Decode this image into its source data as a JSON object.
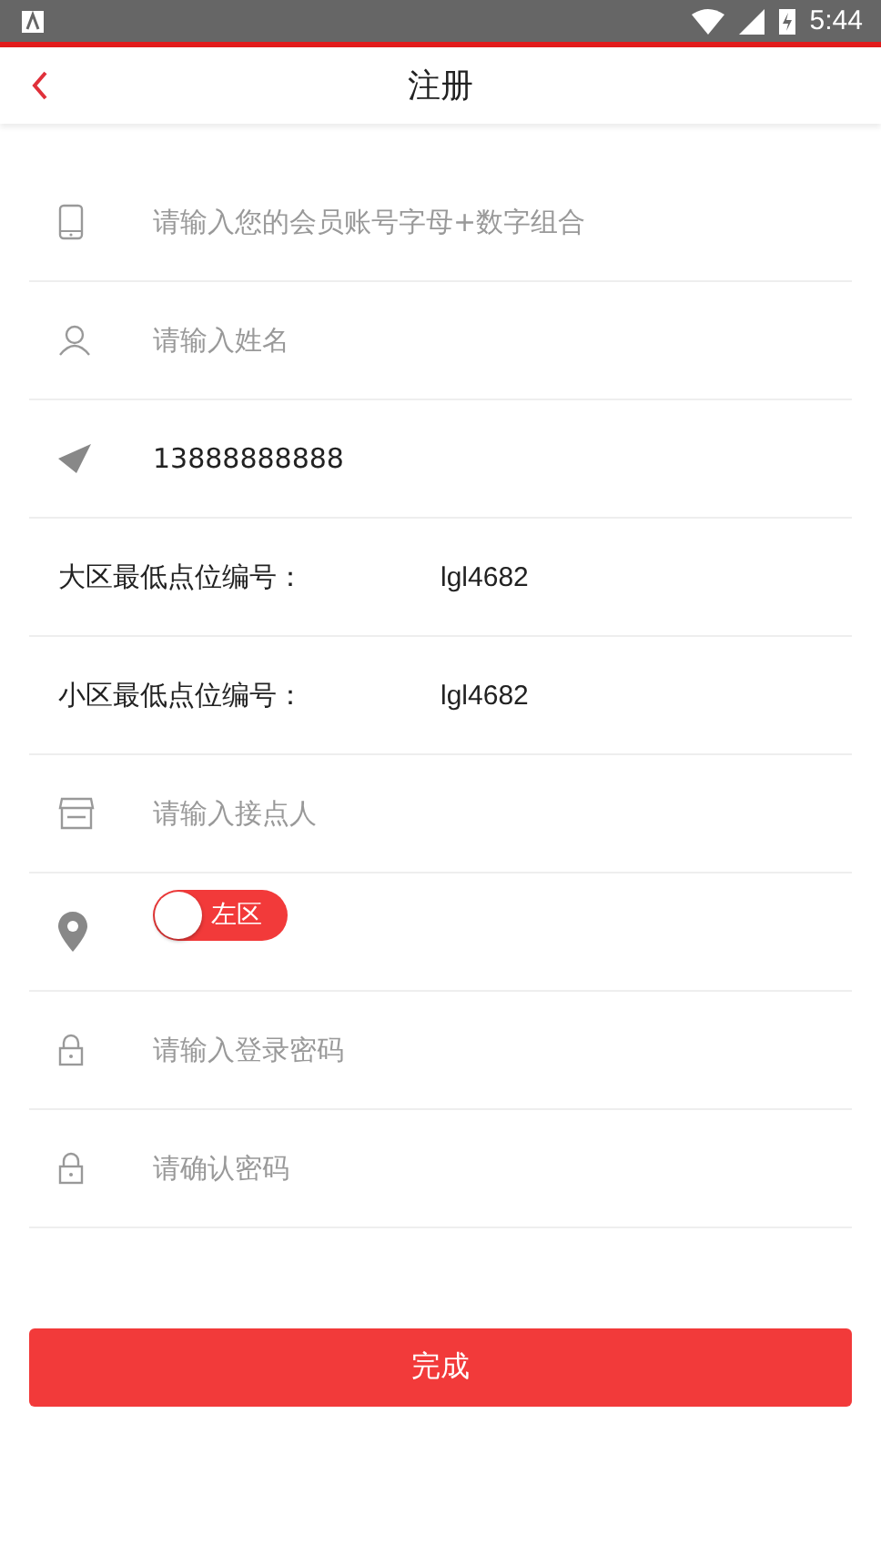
{
  "status_bar": {
    "time": "5:44"
  },
  "header": {
    "title": "注册"
  },
  "rows": [
    {
      "kind": "input",
      "placeholder": "请输入您的会员账号字母+数字组合"
    },
    {
      "kind": "input",
      "placeholder": "请输入姓名"
    },
    {
      "kind": "input",
      "value": "13888888888"
    },
    {
      "kind": "info",
      "label": "大区最低点位编号：",
      "value": "lgl4682"
    },
    {
      "kind": "info",
      "label": "小区最低点位编号：",
      "value": "lgl4682"
    },
    {
      "kind": "input",
      "placeholder": "请输入接点人"
    },
    {
      "kind": "toggle",
      "label": "左区",
      "on": false
    },
    {
      "kind": "input",
      "placeholder": "请输入登录密码"
    },
    {
      "kind": "input",
      "placeholder": "请确认密码"
    }
  ],
  "submit": {
    "label": "完成"
  }
}
